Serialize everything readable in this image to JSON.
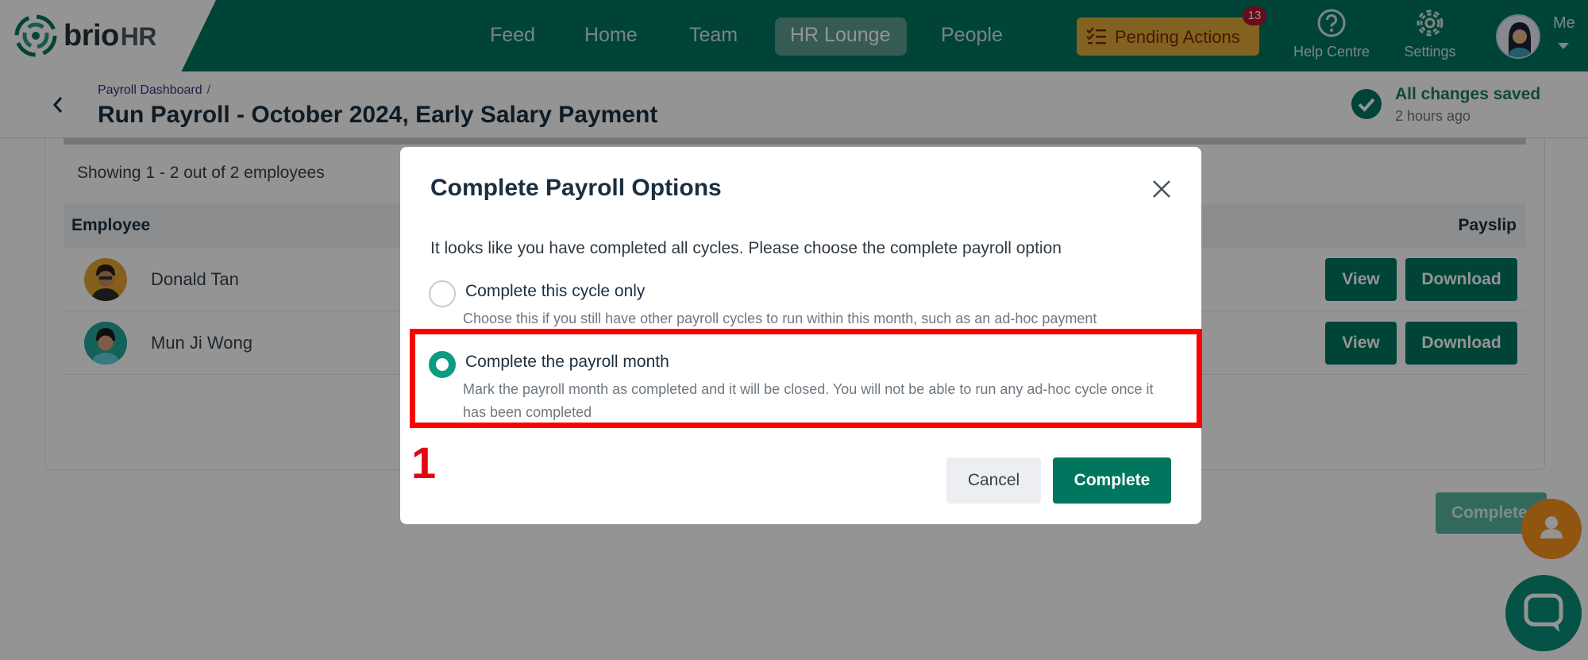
{
  "brand": {
    "name": "brio",
    "suffix": "HR"
  },
  "nav": {
    "items": [
      {
        "label": "Feed"
      },
      {
        "label": "Home"
      },
      {
        "label": "Team"
      },
      {
        "label": "HR Lounge"
      },
      {
        "label": "People"
      }
    ],
    "active": "HR Lounge",
    "pending_actions": {
      "label": "Pending Actions",
      "count": "13"
    },
    "help_centre": "Help Centre",
    "settings": "Settings",
    "me": "Me"
  },
  "header": {
    "breadcrumb": "Payroll Dashboard",
    "breadcrumb_sep": "/",
    "title": "Run Payroll - October 2024, Early Salary Payment",
    "save_status": "All changes saved",
    "save_time": "2 hours ago"
  },
  "table": {
    "showing": "Showing 1 - 2 out of 2 employees",
    "col_employee": "Employee",
    "col_payslip": "Payslip",
    "rows": [
      {
        "name": "Donald Tan",
        "view": "View",
        "download": "Download"
      },
      {
        "name": "Mun Ji Wong",
        "view": "View",
        "download": "Download"
      }
    ],
    "complete_button": "Complete"
  },
  "modal": {
    "title": "Complete Payroll Options",
    "description": "It looks like you have completed all cycles. Please choose the complete payroll option",
    "options": [
      {
        "label": "Complete this cycle only",
        "description": "Choose this if you still have other payroll cycles to run within this month, such as an ad-hoc payment",
        "selected": false
      },
      {
        "label": "Complete the payroll month",
        "description": "Mark the payroll month as completed and it will be closed. You will not be able to run any ad-hoc cycle once it has been completed",
        "selected": true
      }
    ],
    "cancel": "Cancel",
    "complete": "Complete"
  },
  "annotation": {
    "step": "1"
  },
  "colors": {
    "brand_green": "#00765f",
    "radio_selected": "#0a9c82",
    "pending_bg": "#e0aa38",
    "highlight": "#ff0000"
  }
}
